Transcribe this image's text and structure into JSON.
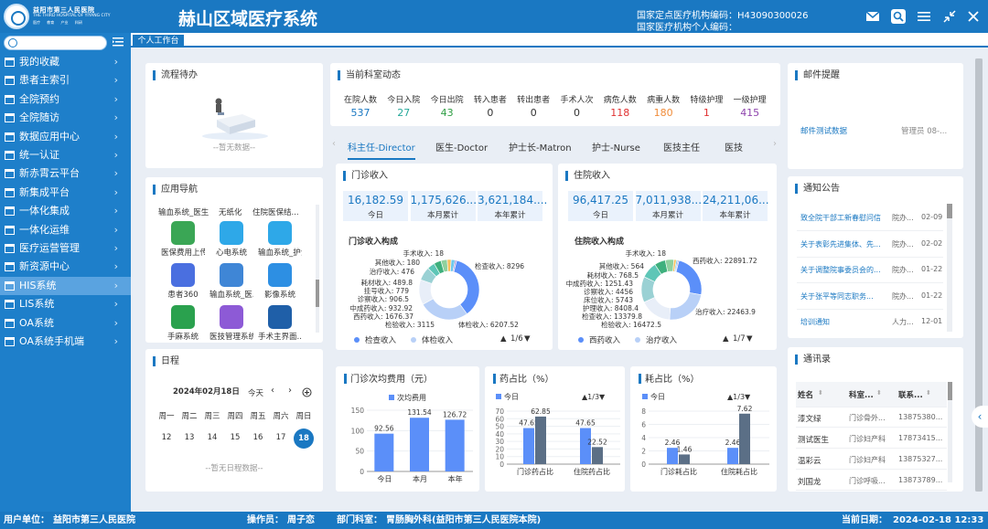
{
  "header": {
    "hospital_name": "益阳市第三人民医院",
    "hospital_en": "THE THIRD HOSPITAL OF YIYANG CITY",
    "hospital_sub": "医疗 教育 产业 科研",
    "title": "赫山区域医疗系统",
    "org_code": "国家定点医疗机构编码：H43090300026",
    "org_code2": "国家医疗机构个人编码："
  },
  "sidebar": {
    "search_placeholder": "",
    "items": [
      {
        "label": "我的收藏"
      },
      {
        "label": "患者主索引"
      },
      {
        "label": "全院预约"
      },
      {
        "label": "全院随访"
      },
      {
        "label": "数据应用中心"
      },
      {
        "label": "统一认证"
      },
      {
        "label": "新赤霄云平台"
      },
      {
        "label": "新集成平台"
      },
      {
        "label": "一体化集成"
      },
      {
        "label": "一体化运维"
      },
      {
        "label": "医疗运营管理"
      },
      {
        "label": "新资源中心"
      },
      {
        "label": "HIS系统"
      },
      {
        "label": "LIS系统"
      },
      {
        "label": "OA系统"
      },
      {
        "label": "OA系统手机端"
      }
    ]
  },
  "tabs": {
    "active": "个人工作台"
  },
  "workflow": {
    "title": "流程待办",
    "empty": "--暂无数据--"
  },
  "app_nav": {
    "title": "应用导航",
    "top_row": [
      "输血系统_医生",
      "无纸化",
      "住院医保结..."
    ],
    "apps": [
      {
        "label": "医保费用上传",
        "color": "#3aa655"
      },
      {
        "label": "心电系统",
        "color": "#2ea8e8"
      },
      {
        "label": "输血系统_护士",
        "color": "#2ea8e8"
      },
      {
        "label": "患者360",
        "color": "#4a6fe0"
      },
      {
        "label": "输血系统_医...",
        "color": "#3f86d6"
      },
      {
        "label": "影像系统",
        "color": "#2d8fe3"
      },
      {
        "label": "手麻系统",
        "color": "#2aa14e"
      },
      {
        "label": "医技管理系统",
        "color": "#8d5ad6"
      },
      {
        "label": "手术主界面...",
        "color": "#1f5fa8"
      }
    ]
  },
  "schedule": {
    "title": "日程",
    "month": "2024年02月18日",
    "today": "今天",
    "weekdays": [
      "周一",
      "周二",
      "周三",
      "周四",
      "周五",
      "周六",
      "周日"
    ],
    "dates": [
      "12",
      "13",
      "14",
      "15",
      "16",
      "17",
      "18"
    ],
    "selected": "18",
    "empty": "--暂无日程数据--"
  },
  "dept": {
    "title": "当前科室动态",
    "stats": [
      {
        "label": "在院人数",
        "value": "537",
        "color": "#1a78c2"
      },
      {
        "label": "今日入院",
        "value": "27",
        "color": "#25a89a"
      },
      {
        "label": "今日出院",
        "value": "43",
        "color": "#2f9e44"
      },
      {
        "label": "转入患者",
        "value": "0",
        "color": "#333333"
      },
      {
        "label": "转出患者",
        "value": "0",
        "color": "#333333"
      },
      {
        "label": "手术人次",
        "value": "0",
        "color": "#333333"
      },
      {
        "label": "病危人数",
        "value": "118",
        "color": "#e03131"
      },
      {
        "label": "病重人数",
        "value": "180",
        "color": "#f08c3a"
      },
      {
        "label": "特级护理",
        "value": "1",
        "color": "#e03131"
      },
      {
        "label": "一级护理",
        "value": "415",
        "color": "#8e44ad"
      }
    ]
  },
  "role_tabs": [
    "科主任-Director",
    "医生-Doctor",
    "护士长-Matron",
    "护士-Nurse",
    "医技主任",
    "医技"
  ],
  "outpatient": {
    "title": "门诊收入",
    "kpis": [
      {
        "value": "16,182.59",
        "label": "今日"
      },
      {
        "value": "1,175,626....",
        "label": "本月累计"
      },
      {
        "value": "3,621,184....",
        "label": "本年累计"
      }
    ],
    "chart_title": "门诊收入构成",
    "legend": [
      "检查收入",
      "体检收入"
    ],
    "pager": "1/6",
    "slices": [
      {
        "label": "检查收入: 8296",
        "value": 8296,
        "color": "#5b8ff9"
      },
      {
        "label": "体检收入: 6207.52",
        "value": 6207.52,
        "color": "#b8d0f7"
      },
      {
        "label": "检验收入: 3115",
        "value": 3115,
        "color": "#e8eef8"
      },
      {
        "label": "西药收入: 1676.37",
        "value": 1676.37,
        "color": "#9ad1d4"
      },
      {
        "label": "中成药收入: 932.92",
        "value": 932.92,
        "color": "#5ec6b7"
      },
      {
        "label": "诊察收入: 906.5",
        "value": 906.5,
        "color": "#3fb07d"
      },
      {
        "label": "挂号收入: 779",
        "value": 779,
        "color": "#8fd19e"
      },
      {
        "label": "耗材收入: 489.8",
        "value": 489.8,
        "color": "#f6c05c"
      },
      {
        "label": "治疗收入: 476",
        "value": 476,
        "color": "#6dc8ec"
      },
      {
        "label": "其他收入: 180",
        "value": 180,
        "color": "#9270ca"
      },
      {
        "label": "手术收入: 18",
        "value": 18,
        "color": "#ff9d4d"
      }
    ]
  },
  "inpatient": {
    "title": "住院收入",
    "kpis": [
      {
        "value": "96,417.25",
        "label": "今日"
      },
      {
        "value": "7,011,938....",
        "label": "本月累计"
      },
      {
        "value": "24,211,06...",
        "label": "本年累计"
      }
    ],
    "chart_title": "住院收入构成",
    "legend": [
      "西药收入",
      "治疗收入"
    ],
    "pager": "1/7",
    "slices": [
      {
        "label": "西药收入: 22891.72",
        "value": 22891.72,
        "color": "#5b8ff9"
      },
      {
        "label": "治疗收入: 22463.9",
        "value": 22463.9,
        "color": "#b8d0f7"
      },
      {
        "label": "检验收入: 16472.5",
        "value": 16472.5,
        "color": "#e8eef8"
      },
      {
        "label": "检查收入: 13379.8",
        "value": 13379.8,
        "color": "#9ad1d4"
      },
      {
        "label": "护理收入: 8408.4",
        "value": 8408.4,
        "color": "#5ec6b7"
      },
      {
        "label": "床位收入: 5743",
        "value": 5743,
        "color": "#3fb07d"
      },
      {
        "label": "诊察收入: 4456",
        "value": 4456,
        "color": "#8fd19e"
      },
      {
        "label": "中成药收入: 1251.43",
        "value": 1251.43,
        "color": "#f6c05c"
      },
      {
        "label": "耗材收入: 768.5",
        "value": 768.5,
        "color": "#6dc8ec"
      },
      {
        "label": "其他收入: 564",
        "value": 564,
        "color": "#9270ca"
      },
      {
        "label": "手术收入: 18",
        "value": 18,
        "color": "#ff9d4d"
      }
    ]
  },
  "chart_data": [
    {
      "type": "bar",
      "title": "门诊次均费用（元）",
      "categories": [
        "今日",
        "本月",
        "本年"
      ],
      "series": [
        {
          "name": "次均费用",
          "values": [
            92.56,
            131.54,
            126.72
          ]
        }
      ],
      "ylim": [
        0,
        150
      ],
      "yticks": [
        "0",
        "50",
        "100",
        "150"
      ]
    },
    {
      "type": "bar",
      "title": "药占比（%）",
      "categories": [
        "门诊药占比",
        "住院药占比"
      ],
      "series": [
        {
          "name": "今日",
          "values": [
            47.65,
            47.65
          ]
        },
        {
          "name": "",
          "values": [
            62.85,
            22.52
          ]
        }
      ],
      "pager": "1/3",
      "ylim": [
        0,
        70
      ],
      "yticks": [
        "0",
        "10",
        "20",
        "30",
        "40",
        "50",
        "60",
        "70"
      ]
    },
    {
      "type": "bar",
      "title": "耗占比（%）",
      "categories": [
        "门诊耗占比",
        "住院耗占比"
      ],
      "series": [
        {
          "name": "今日",
          "values": [
            2.46,
            2.46
          ]
        },
        {
          "name": "",
          "values": [
            1.46,
            7.62
          ]
        }
      ],
      "pager": "1/3",
      "ylim": [
        0,
        8
      ],
      "yticks": [
        "0",
        "2",
        "4",
        "6",
        "8"
      ]
    }
  ],
  "mail": {
    "title": "邮件提醒",
    "subject": "邮件测试数据",
    "sender": "管理员 08-..."
  },
  "notices": {
    "title": "通知公告",
    "items": [
      {
        "title": "致全院干部工新春慰问信",
        "dept": "院办...",
        "date": "02-09"
      },
      {
        "title": "关于表彰先进集体、先...",
        "dept": "院办...",
        "date": "02-02"
      },
      {
        "title": "关于调整院事委员会的...",
        "dept": "院办...",
        "date": "01-22"
      },
      {
        "title": "关于张平等同志职务...",
        "dept": "院办...",
        "date": "01-22"
      },
      {
        "title": "培训通知",
        "dept": "人力...",
        "date": "12-01"
      }
    ]
  },
  "contacts": {
    "title": "通讯录",
    "headers": [
      "姓名",
      "科室...",
      "联系..."
    ],
    "rows": [
      {
        "name": "漆文绿",
        "dept": "门诊骨外...",
        "phone": "13875380..."
      },
      {
        "name": "测试医生",
        "dept": "门诊妇产科",
        "phone": "17873415..."
      },
      {
        "name": "温彩云",
        "dept": "门诊妇产科",
        "phone": "13875327..."
      },
      {
        "name": "刘国龙",
        "dept": "门诊呼吸...",
        "phone": "13873789..."
      }
    ]
  },
  "status": {
    "unit_label": "用户单位：",
    "unit": "益阳市第三人民医院",
    "operator_label": "操作员：",
    "operator": "周子恋",
    "dept_label": "部门科室：",
    "dept": "胃肠胸外科(益阳市第三人民医院本院)",
    "date_label": "当前日期：",
    "date": "2024-02-18 12:33"
  }
}
